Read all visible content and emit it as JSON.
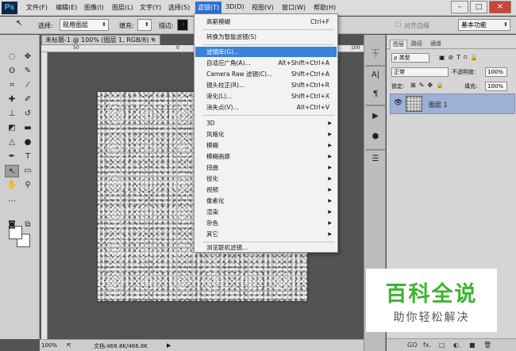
{
  "menubar": {
    "logo": "Ps",
    "items": [
      "文件(F)",
      "编辑(E)",
      "图像(I)",
      "图层(L)",
      "文字(Y)",
      "选择(S)",
      "滤镜(T)",
      "3D(D)",
      "视图(V)",
      "窗口(W)",
      "帮助(H)"
    ],
    "active_item": "滤镜(T)",
    "window_buttons": [
      "–",
      "□",
      "✕"
    ]
  },
  "options_bar": {
    "select_label": "选择:",
    "select_value": "现用图层",
    "fill_label": "填充:",
    "stroke_label": "描边:",
    "align_label": "对齐边缘",
    "workspace": "基本功能"
  },
  "document": {
    "tab_title": "未标题-1 @ 100% (图层 1, RGB/8) *",
    "tab_close": "×",
    "ruler_ticks": [
      "50",
      "0",
      "50",
      "100"
    ]
  },
  "status": {
    "zoom": "100%",
    "doc_info": "文档:468.8K/468.8K"
  },
  "layers_panel": {
    "tabs": [
      "图层",
      "路径",
      "通道"
    ],
    "active_tab": "图层",
    "filter_kind": "类型",
    "blend_mode": "正常",
    "opacity_label": "不透明度:",
    "opacity": "100%",
    "lock_label": "锁定:",
    "fill_label": "填充:",
    "fill": "100%",
    "layers": [
      {
        "name": "图层 1",
        "visible": true
      }
    ],
    "bottom_icons": [
      "GO",
      "fx.",
      "□",
      "◐.",
      "■",
      "🗑"
    ]
  },
  "filter_menu": {
    "items": [
      {
        "label": "高斯模糊",
        "shortcut": "Ctrl+F"
      },
      {
        "label": "转换为智能滤镜(S)",
        "shortcut": ""
      },
      {
        "label": "滤镜库(G)...",
        "shortcut": "",
        "highlighted": true
      },
      {
        "label": "自适应广角(A)...",
        "shortcut": "Alt+Shift+Ctrl+A"
      },
      {
        "label": "Camera Raw 滤镜(C)...",
        "shortcut": "Shift+Ctrl+A"
      },
      {
        "label": "镜头校正(R)...",
        "shortcut": "Shift+Ctrl+R"
      },
      {
        "label": "液化(L)...",
        "shortcut": "Shift+Ctrl+X"
      },
      {
        "label": "消失点(V)...",
        "shortcut": "Alt+Ctrl+V"
      },
      {
        "label": "3D",
        "submenu": true
      },
      {
        "label": "风格化",
        "submenu": true
      },
      {
        "label": "模糊",
        "submenu": true
      },
      {
        "label": "模糊画廊",
        "submenu": true
      },
      {
        "label": "扭曲",
        "submenu": true
      },
      {
        "label": "锐化",
        "submenu": true
      },
      {
        "label": "视频",
        "submenu": true
      },
      {
        "label": "像素化",
        "submenu": true
      },
      {
        "label": "渲染",
        "submenu": true
      },
      {
        "label": "杂色",
        "submenu": true
      },
      {
        "label": "其它",
        "submenu": true
      },
      {
        "label": "浏览联机滤镜...",
        "shortcut": ""
      }
    ]
  },
  "watermark": {
    "title": "百科全说",
    "subtitle": "助你轻松解决"
  },
  "colors": {
    "menu_highlight": "#3a82d6",
    "layer_selected": "#9fb0d6",
    "watermark_green": "#3cb431"
  }
}
